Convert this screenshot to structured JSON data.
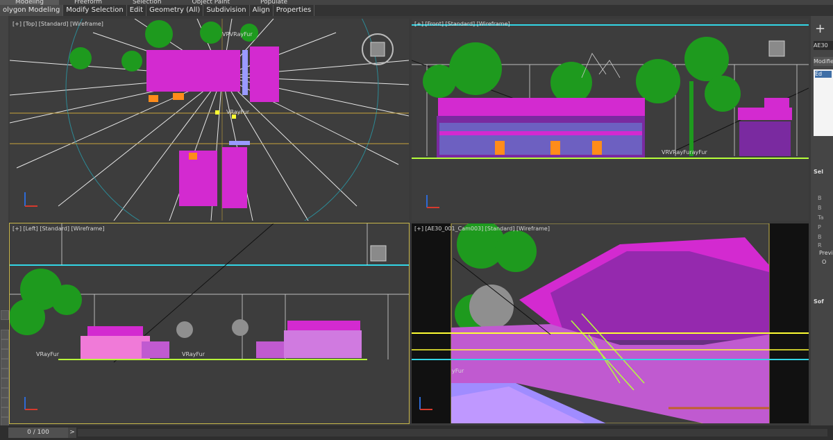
{
  "ribbon_top": [
    "Modeling",
    "Freeform",
    "Selection",
    "Object Paint",
    "Populate"
  ],
  "ribbon_tabs": [
    "olygon Modeling",
    "Modify Selection",
    "Edit",
    "Geometry (All)",
    "Subdivision",
    "Align",
    "Properties"
  ],
  "viewports": {
    "top": {
      "label": "[+] [Top] [Standard] [Wireframe]",
      "tag1": "VRVRayFur",
      "tag2": "VRayFur"
    },
    "front": {
      "label": "[+] [Front] [Standard] [Wireframe]",
      "tag1": "VRVRayFurayFur"
    },
    "left": {
      "label": "[+] [Left] [Standard] [Wireframe]",
      "tag1": "VRayFur",
      "tag2": "VRayFur"
    },
    "cam": {
      "label": "[+] [AE30_001_Cam003] [Standard] [Wireframe]",
      "tag1": "yFur"
    }
  },
  "command_panel": {
    "plus": "+",
    "name_field": "AE30",
    "modifier_list": "Modifie",
    "stack_item": "Ed",
    "section_selection": "Sel",
    "rows": [
      "B",
      "B",
      "Ta",
      "P",
      "B",
      "R"
    ],
    "preview_label": "Previ",
    "preview_opt": "O",
    "section_soft": "Sof"
  },
  "timebar": {
    "frame": "0 / 100",
    "next": ">"
  },
  "colors": {
    "viewport_bg": "#3d3d3d",
    "magenta": "#d32ad0",
    "tree_green": "#1e9a1e",
    "cyan": "#33d6e6",
    "active_border": "#c9b84a"
  }
}
